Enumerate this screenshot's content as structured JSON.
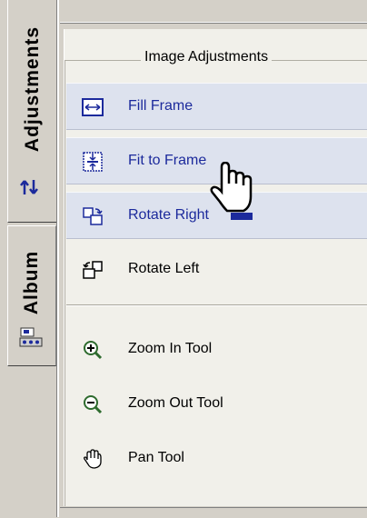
{
  "tabs": [
    {
      "label": "Adjustments",
      "icon": "adjust-arrows-icon"
    },
    {
      "label": "Album",
      "icon": "album-icon"
    }
  ],
  "group_title": "Image Adjustments",
  "items": [
    {
      "label": "Fill Frame",
      "icon": "fill-frame-icon",
      "highlighted": true
    },
    {
      "label": "Fit to Frame",
      "icon": "fit-to-frame-icon",
      "highlighted": true
    },
    {
      "label": "Rotate Right",
      "icon": "rotate-right-icon",
      "highlighted": true
    },
    {
      "label": "Rotate Left",
      "icon": "rotate-left-icon",
      "highlighted": false
    },
    {
      "label": "Zoom In Tool",
      "icon": "zoom-in-icon",
      "highlighted": false
    },
    {
      "label": "Zoom Out Tool",
      "icon": "zoom-out-icon",
      "highlighted": false
    },
    {
      "label": "Pan Tool",
      "icon": "hand-icon",
      "highlighted": false
    }
  ],
  "colors": {
    "link_blue": "#1c2a9c",
    "highlight": "#dde2ee",
    "panel": "#f1f0ea",
    "chrome": "#d4d0c8"
  }
}
